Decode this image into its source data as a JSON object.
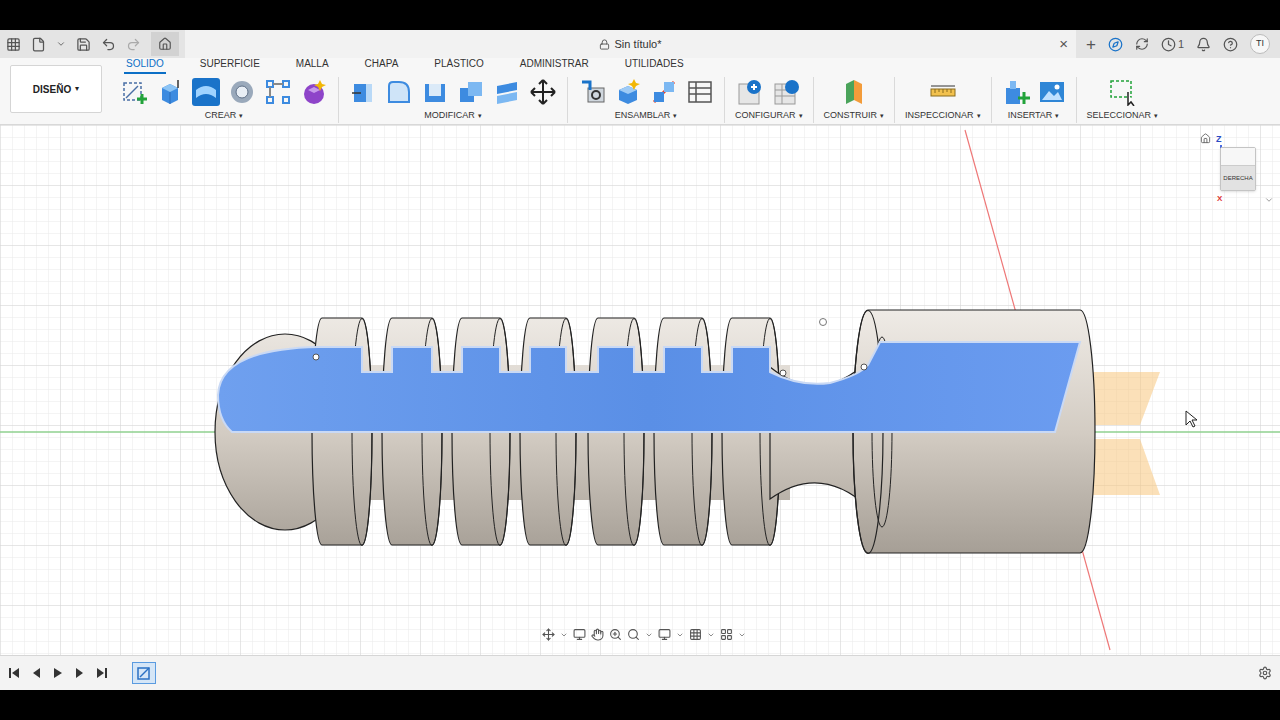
{
  "window": {
    "title": "Sin título*",
    "close": "×",
    "new_tab": "+",
    "notifications": "1",
    "avatar": "TI"
  },
  "dropdown_arrow": "▾",
  "workspace": {
    "label": "DISEÑO"
  },
  "tabs": [
    {
      "label": "SOLIDO",
      "selected": true
    },
    {
      "label": "SUPERFICIE",
      "selected": false
    },
    {
      "label": "MALLA",
      "selected": false
    },
    {
      "label": "CHAPA",
      "selected": false
    },
    {
      "label": "PLÁSTICO",
      "selected": false
    },
    {
      "label": "ADMINISTRAR",
      "selected": false
    },
    {
      "label": "UTILIDADES",
      "selected": false
    }
  ],
  "groups": [
    {
      "label": "CREAR"
    },
    {
      "label": "MODIFICAR"
    },
    {
      "label": "ENSAMBLAR"
    },
    {
      "label": "CONFIGURAR"
    },
    {
      "label": "CONSTRUIR"
    },
    {
      "label": "INSPECCIONAR"
    },
    {
      "label": "INSERTAR"
    },
    {
      "label": "SELECCIONAR"
    }
  ],
  "viewcube": {
    "face": "DERECHA",
    "axis_z": "Z",
    "axis_x": "X"
  }
}
